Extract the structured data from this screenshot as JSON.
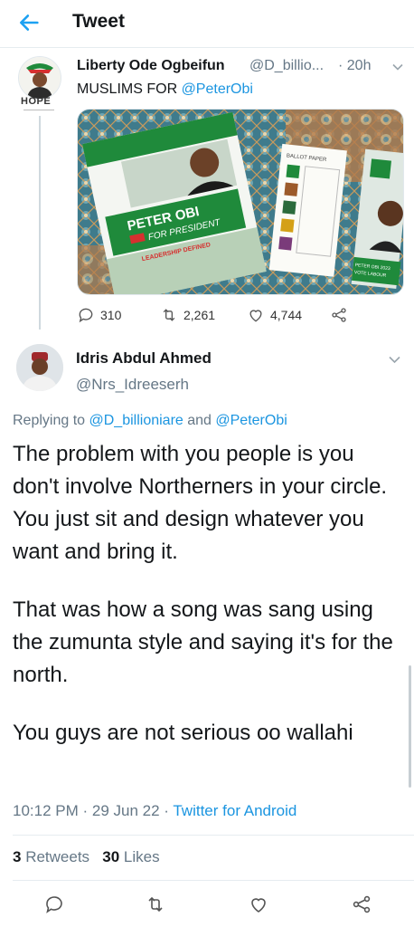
{
  "header": {
    "title": "Tweet",
    "back_icon": "back-arrow-icon",
    "accent": "#1da1f2"
  },
  "parent_tweet": {
    "name": "Liberty Ode Ogbeifun",
    "handle": "@D_billio...",
    "time": "· 20h",
    "avatar_badge": "HOPE",
    "text_prefix": "MUSLIMS FOR ",
    "text_mention": "@PeterObi",
    "image_text": {
      "poster_title": "PETER OBI",
      "poster_subtitle": "FOR PRESIDENT",
      "poster_tag": "LEADERSHIP DEFINED",
      "ballot_header": "BALLOT PAPER",
      "ballot_footer_1": "PETER OBI 2023",
      "ballot_footer_2": "VOTE LABOUR"
    },
    "actions": {
      "replies": "310",
      "retweets": "2,261",
      "likes": "4,744"
    }
  },
  "reply_tweet": {
    "name": "Idris Abdul Ahmed",
    "handle": "@Nrs_Idreeserh",
    "replying_prefix": "Replying to ",
    "replying_to_1": "@D_billioniare",
    "replying_and": " and ",
    "replying_to_2": "@PeterObi",
    "paragraphs": [
      "The problem with you people is you don't involve Northerners in your circle. You just sit and design whatever you want and bring it.",
      "That was how a song was sang using the zumunta style and saying it's for the north.",
      "You guys are not serious oo wallahi"
    ],
    "time": "10:12 PM · 29 Jun 22 · ",
    "source": "Twitter for Android",
    "retweets_count": "3",
    "retweets_label": " Retweets",
    "likes_count": "30",
    "likes_label": " Likes"
  },
  "colors": {
    "link": "#1b95e0",
    "muted": "#657786",
    "text": "#14171a"
  }
}
